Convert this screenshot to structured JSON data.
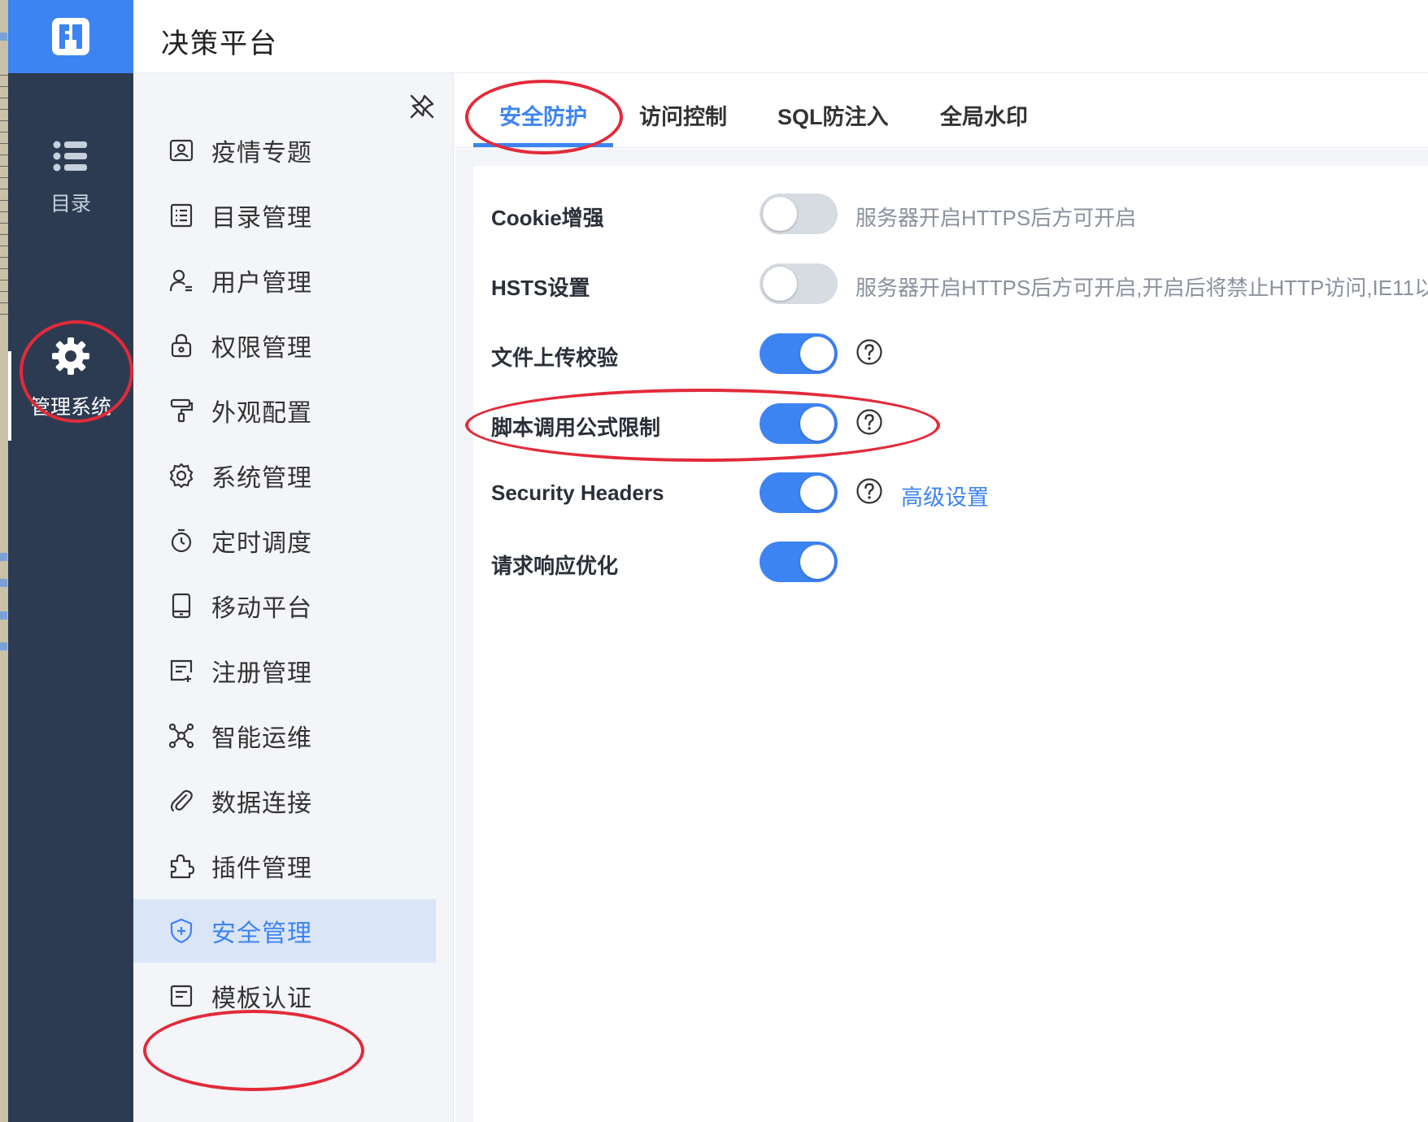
{
  "app": {
    "title": "决策平台"
  },
  "rail": {
    "items": [
      {
        "id": "catalog",
        "label": "目录",
        "icon": "list-icon",
        "active": false
      },
      {
        "id": "management",
        "label": "管理系统",
        "icon": "gear-icon",
        "active": true
      }
    ]
  },
  "submenu": {
    "items": [
      {
        "label": "疫情专题",
        "icon": "monitor-badge-icon"
      },
      {
        "label": "目录管理",
        "icon": "list-doc-icon"
      },
      {
        "label": "用户管理",
        "icon": "user-icon"
      },
      {
        "label": "权限管理",
        "icon": "lock-icon"
      },
      {
        "label": "外观配置",
        "icon": "paint-roller-icon"
      },
      {
        "label": "系统管理",
        "icon": "gear-outline-icon"
      },
      {
        "label": "定时调度",
        "icon": "timer-icon"
      },
      {
        "label": "移动平台",
        "icon": "tablet-icon"
      },
      {
        "label": "注册管理",
        "icon": "register-icon"
      },
      {
        "label": "智能运维",
        "icon": "network-icon"
      },
      {
        "label": "数据连接",
        "icon": "paperclip-icon"
      },
      {
        "label": "插件管理",
        "icon": "puzzle-icon"
      },
      {
        "label": "安全管理",
        "icon": "shield-icon",
        "active": true
      },
      {
        "label": "模板认证",
        "icon": "template-icon"
      }
    ]
  },
  "tabs": [
    {
      "label": "安全防护",
      "active": true
    },
    {
      "label": "访问控制",
      "active": false
    },
    {
      "label": "SQL防注入",
      "active": false
    },
    {
      "label": "全局水印",
      "active": false
    }
  ],
  "settings": [
    {
      "label": "Cookie增强",
      "enabled": false,
      "hint": "服务器开启HTTPS后方可开启",
      "help": false,
      "link": ""
    },
    {
      "label": "HSTS设置",
      "enabled": false,
      "hint": "服务器开启HTTPS后方可开启,开启后将禁止HTTP访问,IE11以",
      "help": false,
      "link": ""
    },
    {
      "label": "文件上传校验",
      "enabled": true,
      "hint": "",
      "help": true,
      "link": ""
    },
    {
      "label": "脚本调用公式限制",
      "enabled": true,
      "hint": "",
      "help": true,
      "link": ""
    },
    {
      "label": "Security Headers",
      "enabled": true,
      "hint": "",
      "help": true,
      "link": "高级设置"
    },
    {
      "label": "请求响应优化",
      "enabled": true,
      "hint": "",
      "help": false,
      "link": ""
    }
  ],
  "colors": {
    "accent": "#3d84f3",
    "rail_bg": "#2d3b52",
    "annotation": "#e32a3a"
  }
}
